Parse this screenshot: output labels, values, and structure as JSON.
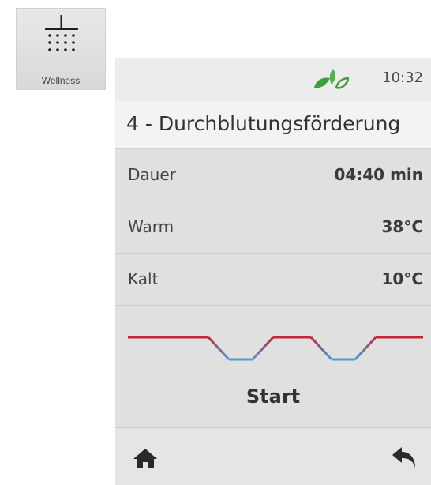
{
  "launcher": {
    "label": "Wellness",
    "icon": "shower-icon"
  },
  "status_bar": {
    "time": "10:32",
    "logo_icon": "leaf-logo-icon",
    "logo_colors": [
      "#3aa13a",
      "#7cc142"
    ]
  },
  "header": {
    "title": "4 - Durchblutungsförderung"
  },
  "settings": [
    {
      "label": "Dauer",
      "value": "04:40 min"
    },
    {
      "label": "Warm",
      "value": "38°C"
    },
    {
      "label": "Kalt",
      "value": "10°C"
    }
  ],
  "program": {
    "graph_colors": {
      "warm": "#c0283a",
      "cold": "#4a9fd8"
    },
    "start_label": "Start"
  },
  "bottom_bar": {
    "home_icon": "home-icon",
    "back_icon": "back-arrow-icon"
  }
}
